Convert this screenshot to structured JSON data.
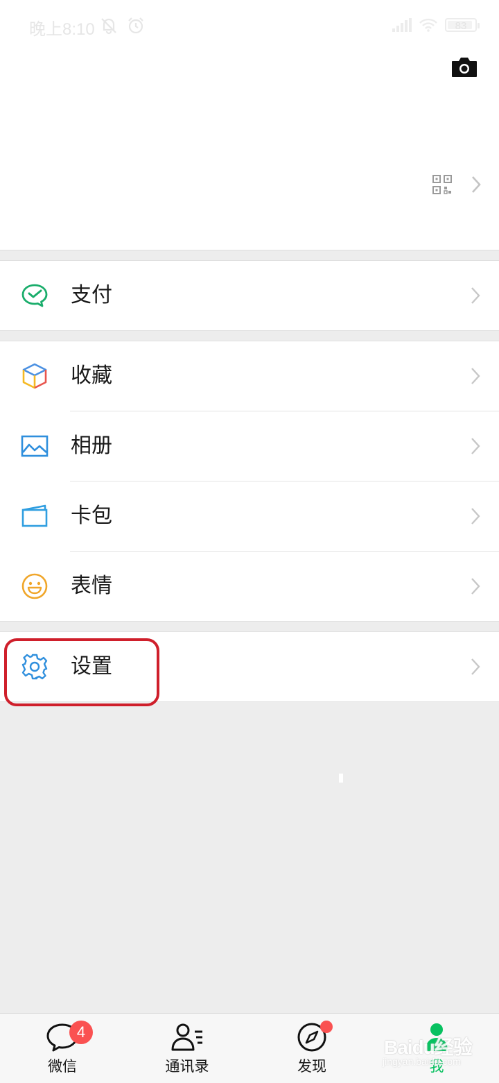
{
  "status_bar": {
    "time": "晚上8:10",
    "battery": "83"
  },
  "menu": {
    "pay": {
      "label": "支付",
      "icon": "wechat-pay-icon"
    },
    "favorites": {
      "label": "收藏",
      "icon": "cube-icon"
    },
    "album": {
      "label": "相册",
      "icon": "picture-icon"
    },
    "cards": {
      "label": "卡包",
      "icon": "card-wallet-icon"
    },
    "stickers": {
      "label": "表情",
      "icon": "smiley-icon"
    },
    "settings": {
      "label": "设置",
      "icon": "gear-icon"
    }
  },
  "tabbar": {
    "chats": {
      "label": "微信",
      "badge": "4"
    },
    "contacts": {
      "label": "通讯录"
    },
    "discover": {
      "label": "发现"
    },
    "me": {
      "label": "我"
    }
  },
  "watermark": {
    "text": "Baidu经验",
    "sub": "jingyan.baidu.com"
  },
  "colors": {
    "accent": "#07c160",
    "badge": "#fa5151",
    "highlight": "#cf1f2b",
    "background": "#ededed"
  }
}
